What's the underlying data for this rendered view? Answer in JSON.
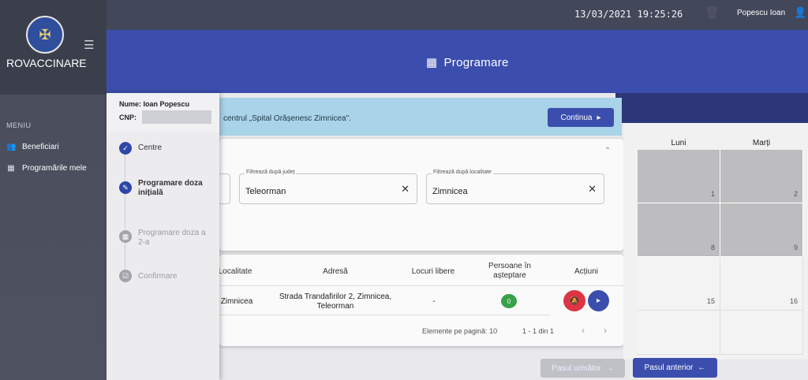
{
  "app": {
    "brand": "ROVACCINARE",
    "logo_icon": "coat-of-arms-icon"
  },
  "topbar": {
    "datetime": "13/03/2021 19:25:26",
    "user_name": "Popescu Ioan"
  },
  "sidebar": {
    "menu_title": "MENIU",
    "items": [
      {
        "label": "Beneficiari",
        "icon": "people-icon"
      },
      {
        "label": "Programările mele",
        "icon": "calendar-icon"
      }
    ]
  },
  "header": {
    "title": "Programare"
  },
  "patient": {
    "name_label": "Nume: Ioan Popescu",
    "cnp_label": "CNP:",
    "cnp_value": ""
  },
  "steps": [
    {
      "label": "Centre",
      "state": "done"
    },
    {
      "label": "Programare doza inițială",
      "state": "active"
    },
    {
      "label": "Programare doza a 2-a",
      "state": "pending"
    },
    {
      "label": "Confirmare",
      "state": "pending"
    }
  ],
  "banner": {
    "text": "centrul „Spital Orășenesc Zimnicea\".",
    "button": "Continua"
  },
  "filters": {
    "county_label": "Filtrează după județ",
    "county_value": "Teleorman",
    "locality_label": "Filtrează după localitate",
    "locality_value": "Zimnicea"
  },
  "table": {
    "headers": [
      "Localitate",
      "Adresă",
      "Locuri libere",
      "Persoane în așteptare",
      "Acțiuni"
    ],
    "rows": [
      {
        "localitate": "Zimnicea",
        "adresa": "Strada Trandafirilor 2, Zimnicea, Teleorman",
        "locuri": "-",
        "asteptare": "0"
      }
    ],
    "per_page_label": "Elemente pe pagină:",
    "per_page_value": "10",
    "range": "1 - 1 din 1"
  },
  "calendar": {
    "days": [
      "Luni",
      "Marți"
    ],
    "row1": [
      "1",
      "2"
    ],
    "row2": [
      "8",
      "9"
    ],
    "row3": [
      "15",
      "16"
    ]
  },
  "footer": {
    "next_label": "Pasul următor",
    "prev_label": "Pasul anterior"
  },
  "colors": {
    "primary": "#3c4ead",
    "danger": "#dc3545",
    "success": "#3aa04a",
    "banner": "#a9d3e8"
  }
}
